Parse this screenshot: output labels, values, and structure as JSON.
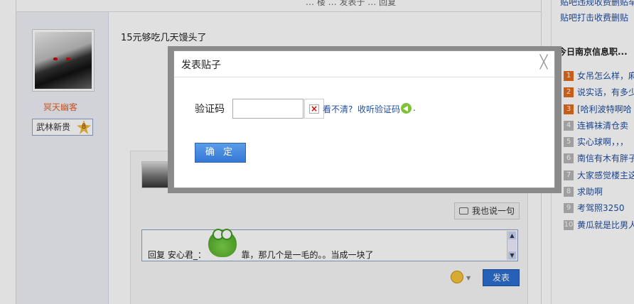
{
  "page": {
    "top_meta": "… 楼 … 发表于 … 回复",
    "post_content": "15元够吃几天馒头了"
  },
  "author": {
    "username": "冥天幽客",
    "rank_label": "武林新贵",
    "rank_level": "8"
  },
  "reply_section": {
    "say_button": "我也说一句",
    "reply_prefix": "回复 安心君_：",
    "reply_suffix": "靠，那几个是一毛的。。当成一块了",
    "send_button": "发表"
  },
  "sidebar": {
    "top_link": "贴吧违规收费删贴举报",
    "link": "贴吧打击收费删贴",
    "title": "今日南京信息职...",
    "items": [
      {
        "num": "1",
        "text": "女吊怎么样，麻"
      },
      {
        "num": "2",
        "text": "说实话，有多少"
      },
      {
        "num": "3",
        "text": "[哈利波特啊哈"
      },
      {
        "num": "4",
        "text": "连裤袜清仓卖"
      },
      {
        "num": "5",
        "text": "实心球啊，，，"
      },
      {
        "num": "6",
        "text": "南信有木有胖子"
      },
      {
        "num": "7",
        "text": "大家感觉楼主这"
      },
      {
        "num": "8",
        "text": "求助啊"
      },
      {
        "num": "9",
        "text": "考驾照3250"
      },
      {
        "num": "10",
        "text": "黄瓜就是比男人"
      }
    ]
  },
  "dialog": {
    "title": "发表贴子",
    "close_symbol": "╳",
    "captcha_label": "验证码",
    "captcha_value": "",
    "refresh_link": "看不清?",
    "listen_link": "收听验证码",
    "trailing_dot": ".",
    "confirm_button": "确 定"
  },
  "colors": {
    "accent": "#3578d6",
    "link": "#1f4ea0",
    "username": "#e0602a",
    "hot_rank": "#e46a1b"
  }
}
